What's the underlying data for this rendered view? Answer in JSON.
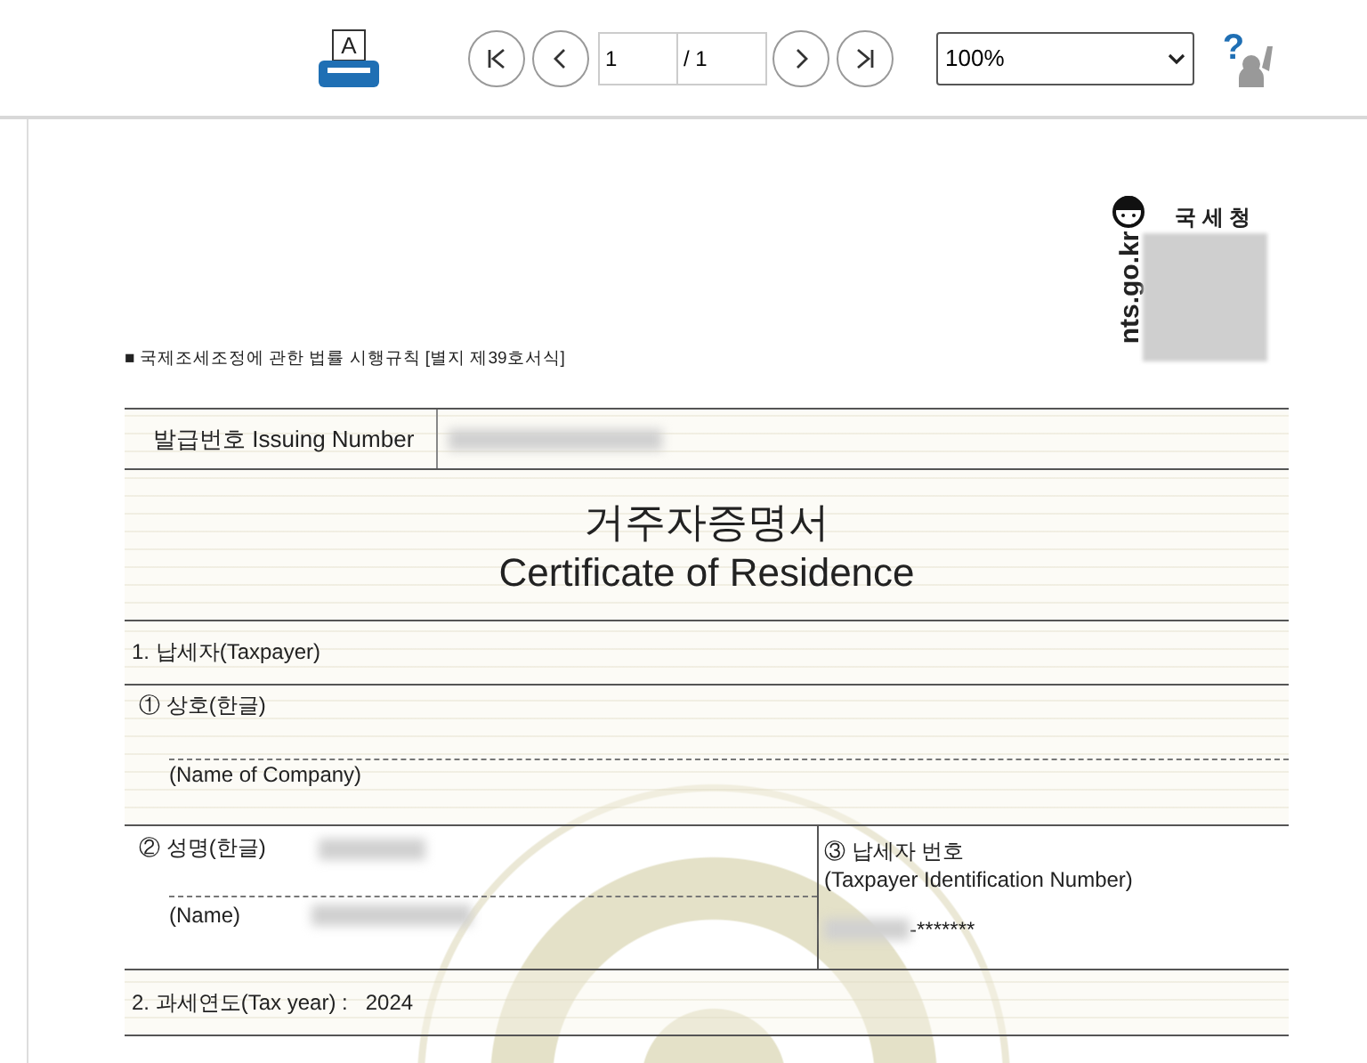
{
  "toolbar": {
    "print_icon_letter": "A",
    "help_icon_mark": "?",
    "page_current": "1",
    "page_total": "/ 1",
    "zoom": "100%"
  },
  "document": {
    "logo": {
      "agency": "국 세 청",
      "site": "nts.go.kr"
    },
    "form_reference": "■ 국제조세조정에 관한 법률 시행규칙 [별지 제39호서식]",
    "issuing_label": "발급번호 Issuing Number",
    "title_ko": "거주자증명서",
    "title_en": "Certificate of Residence",
    "section_taxpayer": "1. 납세자(Taxpayer)",
    "company_label_ko": "① 상호(한글)",
    "company_label_en": "(Name of Company)",
    "name_label_ko": "② 성명(한글)",
    "name_label_en": "(Name)",
    "tin_label_ko": "③ 납세자 번호",
    "tin_label_en": "(Taxpayer Identification Number)",
    "tin_suffix": "-*******",
    "tax_year_label": "2. 과세연도(Tax year) :",
    "tax_year": "2024"
  }
}
